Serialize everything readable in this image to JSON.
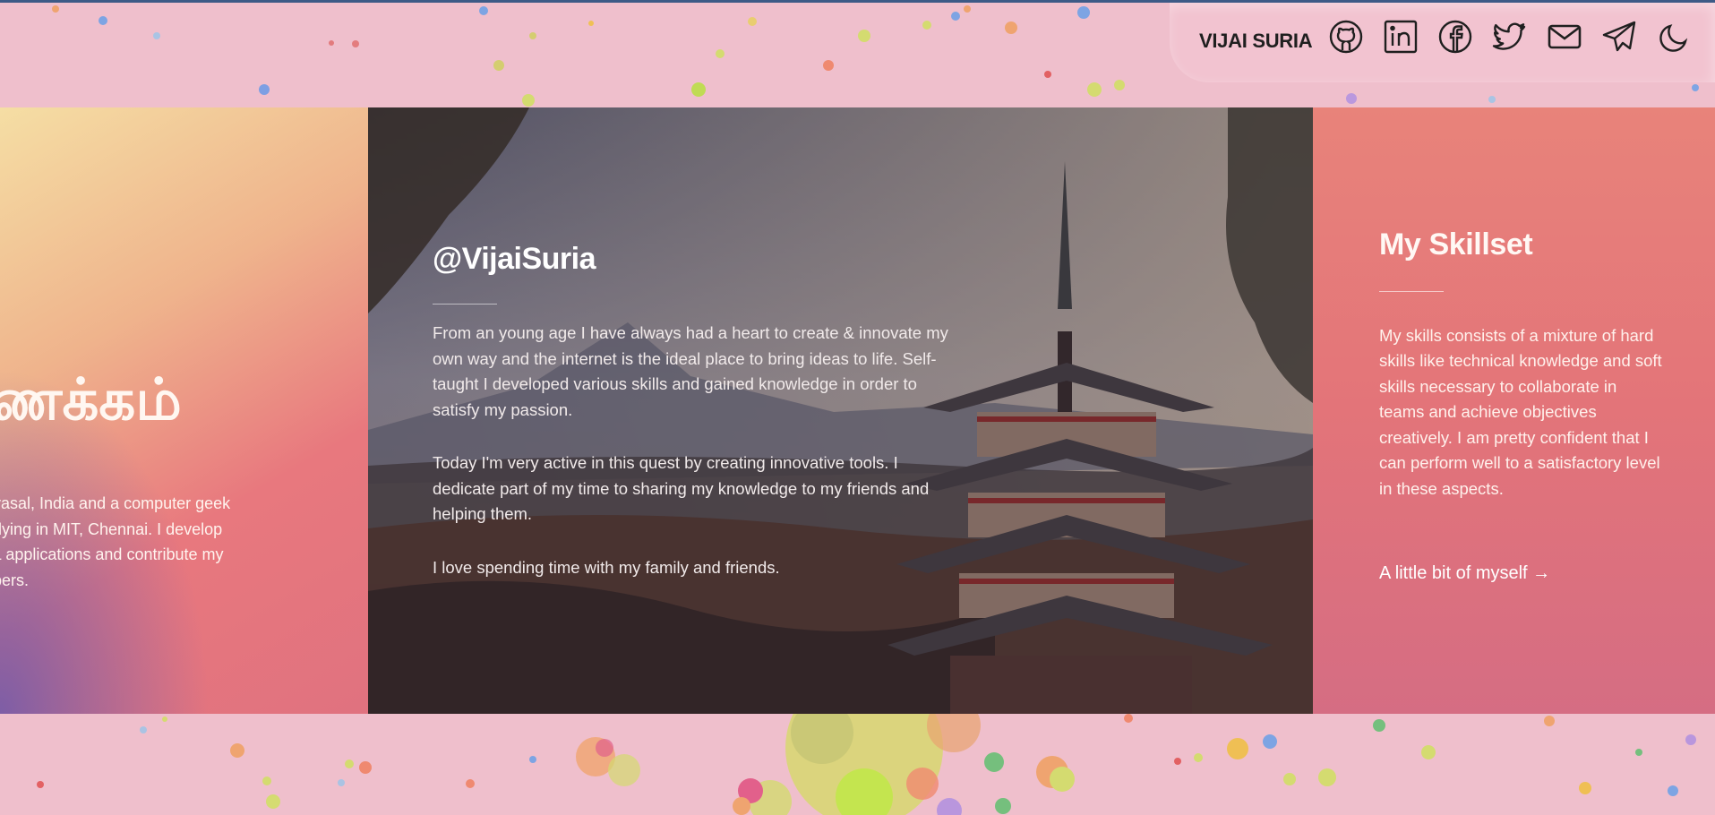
{
  "header": {
    "brand": "VIJAI SURIA",
    "icons": [
      "github-icon",
      "linkedin-icon",
      "facebook-icon",
      "twitter-icon",
      "mail-icon",
      "telegram-icon",
      "moon-icon"
    ]
  },
  "left_panel": {
    "greeting": "ணக்கம்",
    "lines": [
      "vasal, India and a computer geek",
      "dying in MIT, Chennai. I develop",
      "L applications and contribute my",
      "pers."
    ]
  },
  "center_panel": {
    "handle": "@VijaiSuria",
    "paragraphs": [
      "From an young age I have always had a heart to create & innovate my own way and the internet is the ideal place to bring ideas to life. Self-taught I developed various skills and gained knowledge in order to satisfy my passion.",
      "Today I'm very active in this quest by creating innovative tools. I dedicate part of my time to sharing my knowledge to my friends and helping them.",
      "I love spending time with my family and friends."
    ]
  },
  "right_panel": {
    "title": "My Skillset",
    "text": "My skills consists of a mixture of hard skills like technical knowledge and soft skills necessary to collaborate in teams and achieve objectives creatively. I am pretty confident that I can perform well to a satisfactory level in these aspects.",
    "link": "A little bit of myself →"
  },
  "colors": {
    "background": "#efbfcc",
    "accent_pink": "#e37479",
    "brand_text": "#1f1f1f"
  }
}
